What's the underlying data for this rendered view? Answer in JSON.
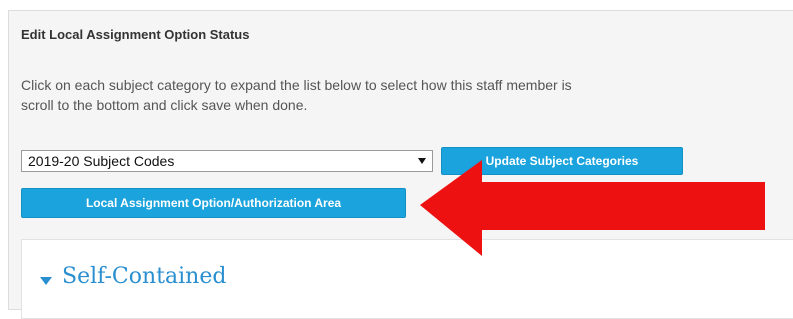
{
  "panel": {
    "title": "Edit Local Assignment Option Status",
    "instructions": [
      "Click on each subject category to expand the list below to select how this staff member is",
      "scroll to the bottom and click save when done."
    ]
  },
  "subject_codes_select": {
    "selected": "2019-20 Subject Codes"
  },
  "buttons": {
    "update_label": "Update Subject Categories",
    "local_label": "Local Assignment Option/Authorization Area"
  },
  "section": {
    "title": "Self-Contained"
  },
  "colors": {
    "accent_blue": "#1aa3dc",
    "section_title_blue": "#2a8fd0",
    "annotation_arrow_red": "#ee1111"
  },
  "icons": {
    "dropdown": "chevron-down-icon",
    "section": "caret-down-icon",
    "annotation": "arrow-left-icon"
  }
}
